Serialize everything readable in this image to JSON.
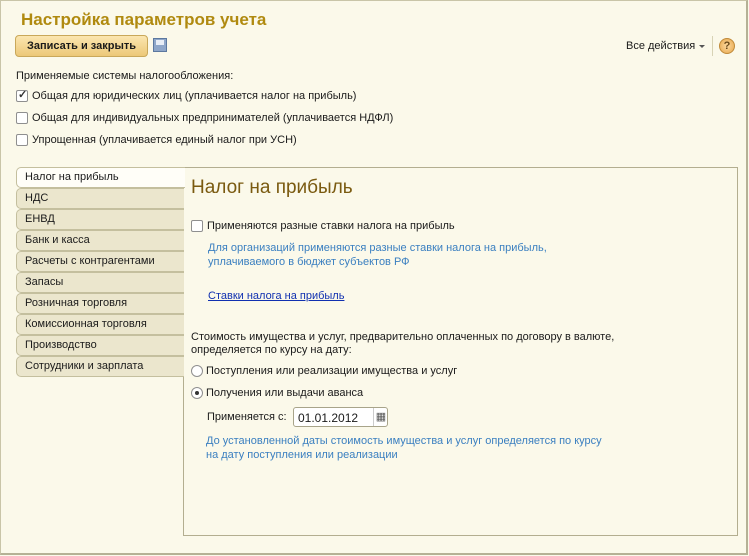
{
  "title": "Настройка параметров учета",
  "toolbar": {
    "save_close": "Записать и закрыть",
    "all_actions": "Все действия",
    "help": "?"
  },
  "tax_systems": {
    "label": "Применяемые системы налогообложения:",
    "items": [
      {
        "label": "Общая для юридических лиц (уплачивается налог на прибыль)",
        "checked": true
      },
      {
        "label": "Общая для индивидуальных предпринимателей (уплачивается НДФЛ)",
        "checked": false
      },
      {
        "label": "Упрощенная (уплачивается единый налог при УСН)",
        "checked": false
      }
    ]
  },
  "tabs": [
    "Налог на прибыль",
    "НДС",
    "ЕНВД",
    "Банк и касса",
    "Расчеты с контрагентами",
    "Запасы",
    "Розничная торговля",
    "Комиссионная торговля",
    "Производство",
    "Сотрудники и зарплата"
  ],
  "panel": {
    "heading": "Налог на прибыль",
    "diff_rates_label": "Применяются разные ставки налога на прибыль",
    "diff_rates_checked": false,
    "diff_rates_hint1": "Для организаций применяются разные ставки налога на прибыль,",
    "diff_rates_hint2": "уплачиваемого в бюджет субъектов РФ",
    "rates_link": "Ставки налога на прибыль",
    "cost_label1": "Стоимость имущества и услуг, предварительно оплаченных по договору в валюте,",
    "cost_label2": "определяется по курсу на дату:",
    "radio1": "Поступления или реализации имущества и услуг",
    "radio2": "Получения или выдачи аванса",
    "selected_radio": 2,
    "applies_from_label": "Применяется с:",
    "applies_from_value": "01.01.2012",
    "hint1": "До установленной даты стоимость имущества и услуг определяется по курсу",
    "hint2": "на дату поступления или реализации"
  }
}
